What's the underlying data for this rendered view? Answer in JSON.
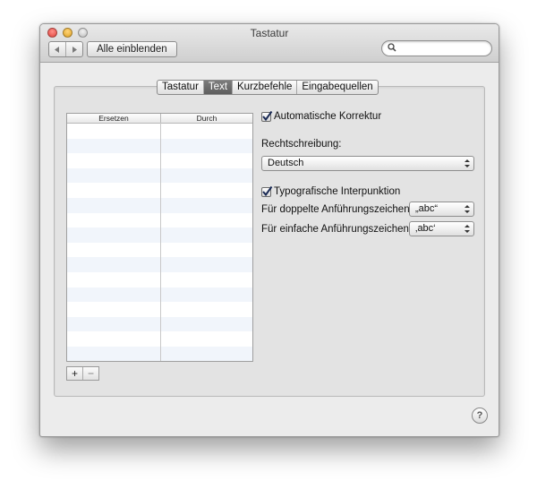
{
  "window": {
    "title": "Tastatur"
  },
  "toolbar": {
    "back_icon": "back-icon",
    "forward_icon": "forward-icon",
    "show_all_label": "Alle einblenden",
    "search_value": "",
    "search_icon": "search-icon"
  },
  "tabs": [
    {
      "label": "Tastatur",
      "active": false
    },
    {
      "label": "Text",
      "active": true
    },
    {
      "label": "Kurzbefehle",
      "active": false
    },
    {
      "label": "Eingabequellen",
      "active": false
    }
  ],
  "table": {
    "columns": [
      "Ersetzen",
      "Durch"
    ],
    "rows": [],
    "add_label": "+",
    "remove_label": "−"
  },
  "options": {
    "autocorrect": {
      "label": "Automatische Korrektur",
      "checked": true
    },
    "spelling_label": "Rechtschreibung:",
    "spelling_value": "Deutsch",
    "smart_punct": {
      "label": "Typografische Interpunktion",
      "checked": true
    },
    "double_quotes_label": "Für doppelte Anführungszeichen",
    "double_quotes_value": "„abc“",
    "single_quotes_label": "Für einfache Anführungszeichen",
    "single_quotes_value": "‚abc‘"
  },
  "help_label": "?",
  "colors": {
    "window_bg": "#ececec",
    "tab_active": "#6b6b6b",
    "row_alt": "#f1f5fb"
  }
}
